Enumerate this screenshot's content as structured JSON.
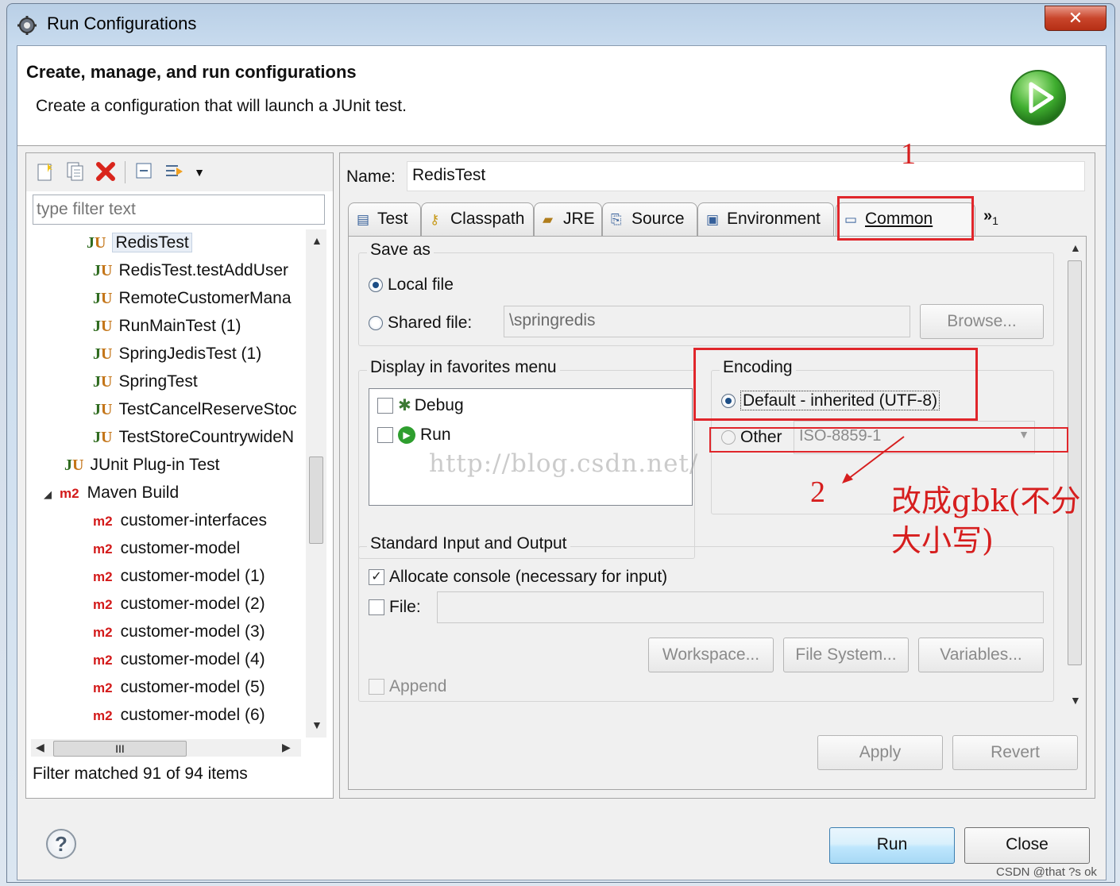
{
  "window": {
    "title": "Run Configurations",
    "close_glyph": "✕"
  },
  "header": {
    "title": "Create, manage, and run configurations",
    "subtitle": "Create a configuration that will launch a JUnit test."
  },
  "left_panel": {
    "toolbar_icons": [
      "new-launch-config-icon",
      "duplicate-icon",
      "delete-icon",
      "collapse-all-icon",
      "filter-icon",
      "dropdown-icon"
    ],
    "filter_placeholder": "type filter text",
    "tree": [
      {
        "kind": "ju",
        "label": "RedisTest",
        "selected": true
      },
      {
        "kind": "ju",
        "label": "RedisTest.testAddUser"
      },
      {
        "kind": "ju",
        "label": "RemoteCustomerMana"
      },
      {
        "kind": "ju",
        "label": "RunMainTest (1)"
      },
      {
        "kind": "ju",
        "label": "SpringJedisTest (1)"
      },
      {
        "kind": "ju",
        "label": "SpringTest"
      },
      {
        "kind": "ju",
        "label": "TestCancelReserveStoc"
      },
      {
        "kind": "ju",
        "label": "TestStoreCountrywideN"
      },
      {
        "kind": "plugin",
        "label": "JUnit Plug-in Test"
      },
      {
        "kind": "m2-parent",
        "label": "Maven Build"
      },
      {
        "kind": "m2",
        "label": "customer-interfaces"
      },
      {
        "kind": "m2",
        "label": "customer-model"
      },
      {
        "kind": "m2",
        "label": "customer-model (1)"
      },
      {
        "kind": "m2",
        "label": "customer-model (2)"
      },
      {
        "kind": "m2",
        "label": "customer-model (3)"
      },
      {
        "kind": "m2",
        "label": "customer-model (4)"
      },
      {
        "kind": "m2",
        "label": "customer-model (5)"
      },
      {
        "kind": "m2",
        "label": "customer-model (6)"
      }
    ],
    "ju_prefix": "J",
    "ju_suffix": "U",
    "m2_badge": "m2",
    "hscroll_grip": "III",
    "filter_status": "Filter matched 91 of 94 items"
  },
  "right_panel": {
    "name_label": "Name:",
    "name_value": "RedisTest",
    "tabs": [
      {
        "label": "Test",
        "icon": "test-icon"
      },
      {
        "label": "Classpath",
        "icon": "classpath-icon"
      },
      {
        "label": "JRE",
        "icon": "jre-icon"
      },
      {
        "label": "Source",
        "icon": "source-icon"
      },
      {
        "label": "Environment",
        "icon": "environment-icon"
      },
      {
        "label": "Common",
        "icon": "common-icon",
        "active": true
      }
    ],
    "more_tabs": "»",
    "more_tabs_count": "1",
    "save_as": {
      "label": "Save as",
      "local_file": "Local file",
      "shared_file": "Shared file:",
      "shared_path": "\\springredis",
      "browse": "Browse..."
    },
    "favorites": {
      "label": "Display in favorites menu",
      "items": [
        "Debug",
        "Run"
      ]
    },
    "encoding": {
      "label": "Encoding",
      "default": "Default - inherited (UTF-8)",
      "other": "Other",
      "other_value": "ISO-8859-1"
    },
    "std_io": {
      "label": "Standard Input and Output",
      "allocate_console": "Allocate console (necessary for input)",
      "file": "File:",
      "workspace": "Workspace...",
      "file_system": "File System...",
      "variables": "Variables...",
      "append": "Append"
    },
    "apply": "Apply",
    "revert": "Revert"
  },
  "footer": {
    "help": "?",
    "run": "Run",
    "close": "Close"
  },
  "annotations": {
    "num1": "1",
    "num2": "2",
    "note": "改成gbk(不分大小写)",
    "watermark": "http://blog.csdn.net/",
    "csdn_credit": "CSDN @that ?s  ok"
  },
  "colors": {
    "annotation_red": "#e0262b",
    "junit_green": "#2f6b1f",
    "maven_red": "#d31a1a",
    "run_green": "#2e9e2e"
  }
}
